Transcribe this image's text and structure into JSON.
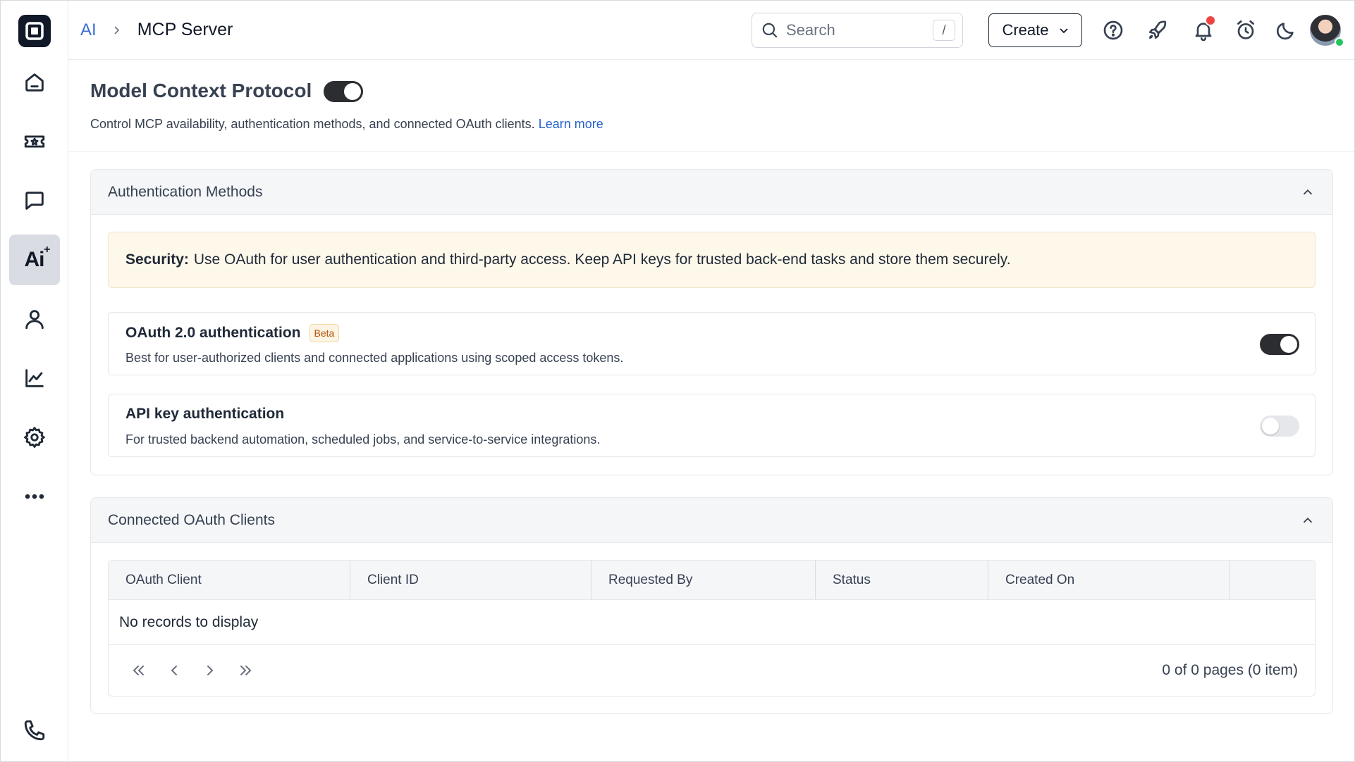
{
  "header": {
    "breadcrumb_parent": "AI",
    "breadcrumb_current": "MCP Server",
    "search_placeholder": "Search",
    "search_shortcut": "/",
    "create_label": "Create"
  },
  "sidebar": {
    "ai_label": "Ai",
    "items": [
      {
        "name": "home-icon"
      },
      {
        "name": "ticket-icon"
      },
      {
        "name": "chat-icon"
      },
      {
        "name": "ai-icon",
        "active": true
      },
      {
        "name": "user-icon"
      },
      {
        "name": "analytics-icon"
      },
      {
        "name": "settings-icon"
      },
      {
        "name": "more-icon"
      },
      {
        "name": "phone-icon"
      }
    ]
  },
  "page": {
    "title": "Model Context Protocol",
    "enabled": true,
    "description": "Control MCP availability, authentication methods, and connected OAuth clients.",
    "learn_more": "Learn more"
  },
  "auth_section": {
    "title": "Authentication Methods",
    "banner_label": "Security:",
    "banner_text": "Use OAuth for user authentication and third-party access. Keep API keys for trusted back-end tasks and store them securely.",
    "methods": [
      {
        "title": "OAuth 2.0 authentication",
        "badge": "Beta",
        "description": "Best for user-authorized clients and connected applications using scoped access tokens.",
        "enabled": true
      },
      {
        "title": "API key authentication",
        "description": "For trusted backend automation, scheduled jobs, and service-to-service integrations.",
        "enabled": false
      }
    ]
  },
  "clients_section": {
    "title": "Connected OAuth Clients",
    "columns": [
      "OAuth Client",
      "Client ID",
      "Requested By",
      "Status",
      "Created On"
    ],
    "empty_text": "No records to display",
    "pager_info": "0 of 0 pages (0 item)"
  },
  "colors": {
    "accent": "#3b6fd4",
    "link": "#2563c9",
    "toggle_on": "#2b2d31",
    "banner_bg": "#fdf8ea",
    "notification": "#ef4444",
    "online": "#22c55e"
  }
}
